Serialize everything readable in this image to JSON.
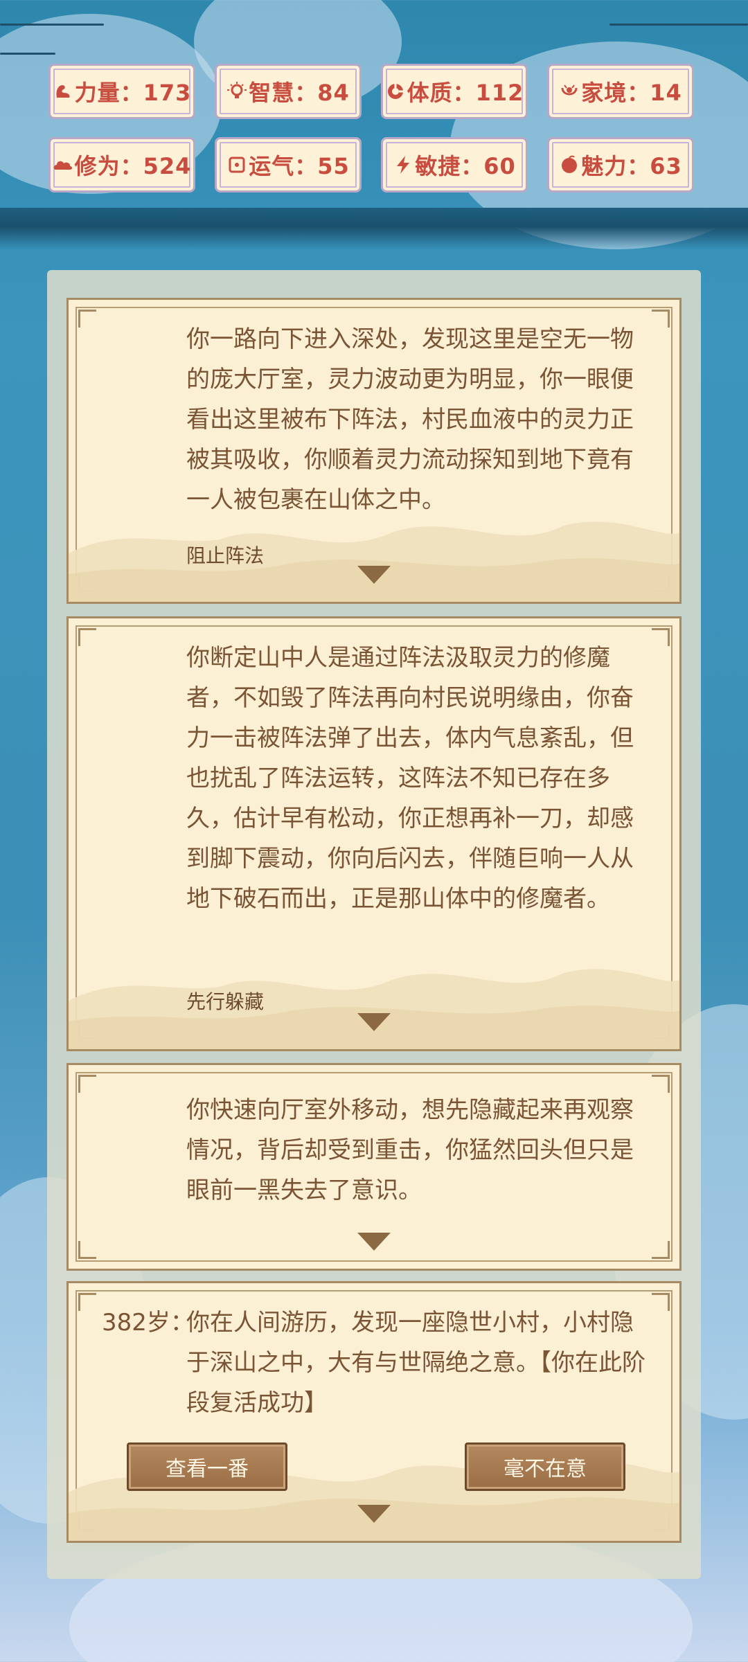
{
  "stats": [
    {
      "label": "力量：173",
      "icon": "strength-icon"
    },
    {
      "label": "智慧：84",
      "icon": "bulb-icon"
    },
    {
      "label": "体质：112",
      "icon": "constitution-icon"
    },
    {
      "label": "家境：14",
      "icon": "family-icon"
    },
    {
      "label": "修为：524",
      "icon": "cloud-icon"
    },
    {
      "label": "运气：55",
      "icon": "luck-icon"
    },
    {
      "label": "敏捷：60",
      "icon": "lightning-icon"
    },
    {
      "label": "魅力：63",
      "icon": "charm-icon"
    }
  ],
  "events": [
    {
      "text": "你一路向下进入深处，发现这里是空无一物的庞大厅室，灵力波动更为明显，你一眼便看出这里被布下阵法，村民血液中的灵力正被其吸收，你顺着灵力流动探知到地下竟有一人被包裹在山体之中。",
      "choice": "阻止阵法"
    },
    {
      "text": "你断定山中人是通过阵法汲取灵力的修魔者，不如毁了阵法再向村民说明缘由，你奋力一击被阵法弹了出去，体内气息紊乱，但也扰乱了阵法运转，这阵法不知已存在多久，估计早有松动，你正想再补一刀，却感到脚下震动，你向后闪去，伴随巨响一人从地下破石而出，正是那山体中的修魔者。",
      "choice": "先行躲藏"
    },
    {
      "text": "你快速向厅室外移动，想先隐藏起来再观察情况，背后却受到重击，你猛然回头但只是眼前一黑失去了意识。",
      "choice": ""
    }
  ],
  "current": {
    "age": "382岁：",
    "text": "你在人间游历，发现一座隐世小村，小村隐于深山之中，大有与世隔绝之意。【你在此阶段复活成功】",
    "button_left": "查看一番",
    "button_right": "毫不在意"
  },
  "colors": {
    "stat_text": "#c94d3f",
    "card_bg": "#fbf0d4",
    "card_text": "#7a5434",
    "frame": "#a58a63",
    "button": "#a47650"
  }
}
